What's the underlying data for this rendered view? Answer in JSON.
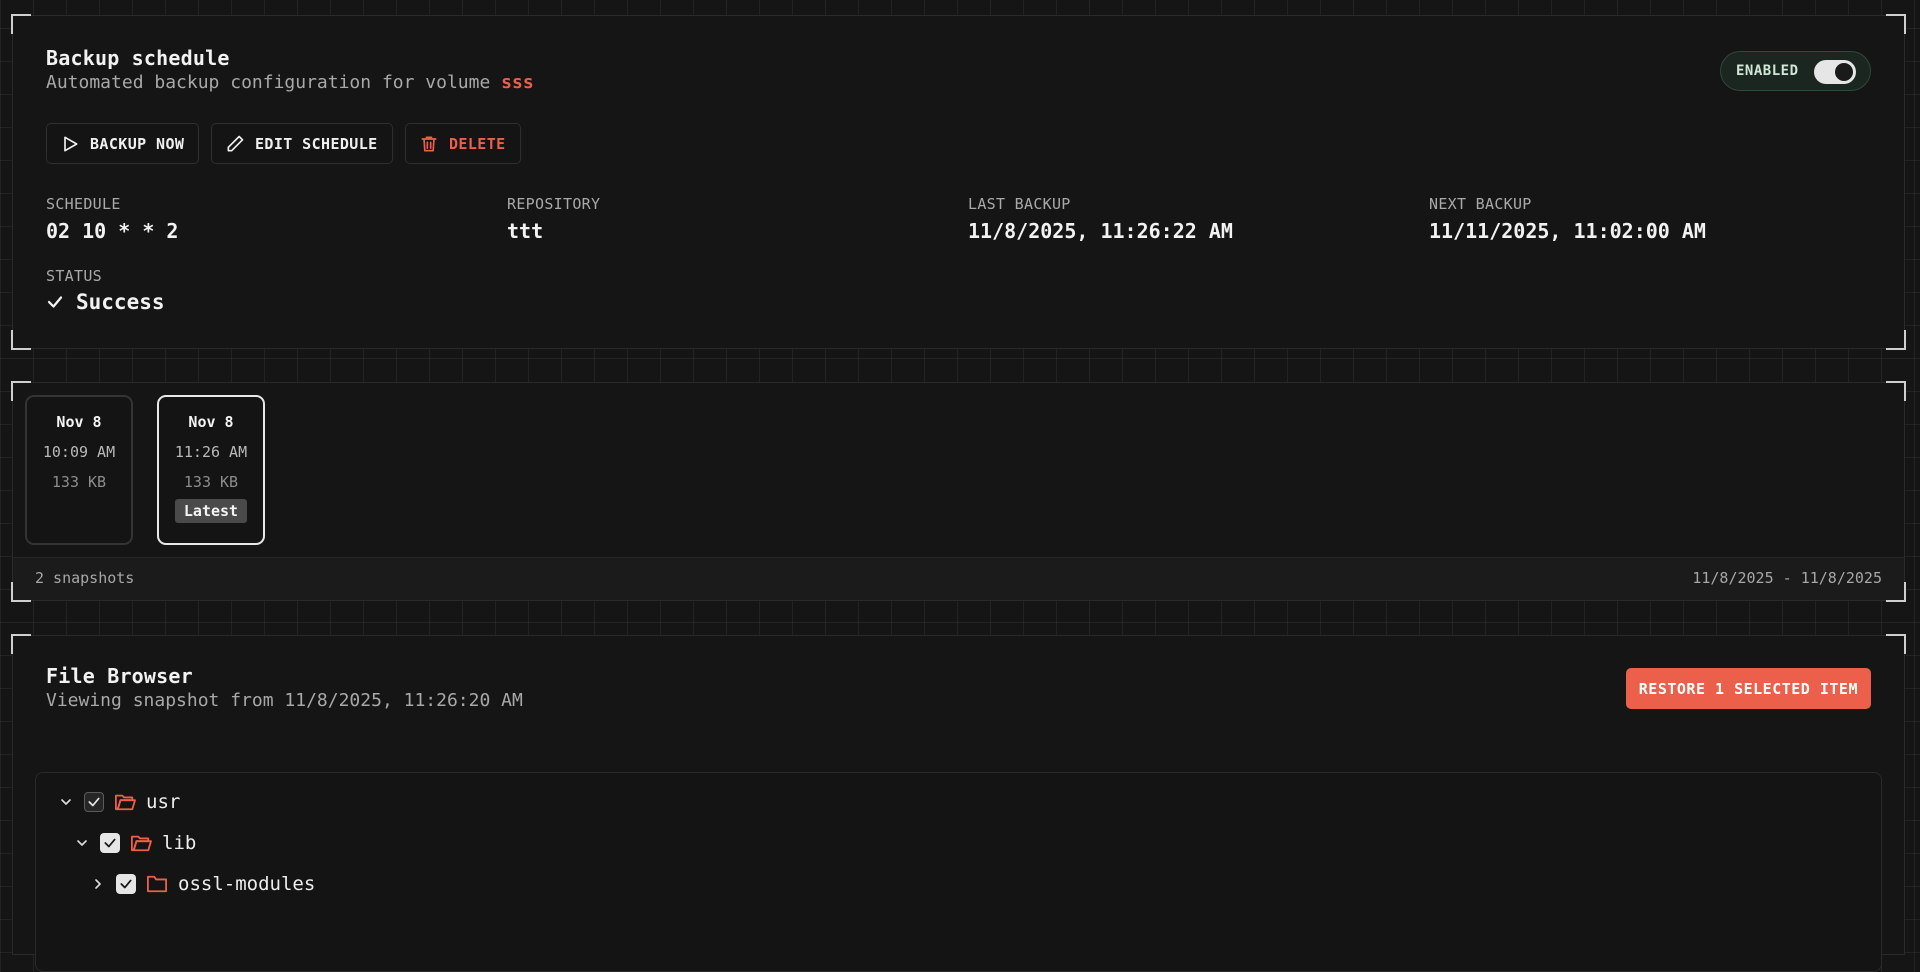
{
  "schedule": {
    "title": "Backup schedule",
    "subtitle_prefix": "Automated backup configuration for volume",
    "volume": "sss",
    "toggle_label": "ENABLED",
    "buttons": {
      "backup_now": "BACKUP NOW",
      "edit_schedule": "EDIT SCHEDULE",
      "delete": "DELETE"
    },
    "fields": {
      "schedule_label": "SCHEDULE",
      "schedule_value": "02 10 * * 2",
      "repository_label": "REPOSITORY",
      "repository_value": "ttt",
      "last_backup_label": "LAST BACKUP",
      "last_backup_value": "11/8/2025, 11:26:22 AM",
      "next_backup_label": "NEXT BACKUP",
      "next_backup_value": "11/11/2025, 11:02:00 AM",
      "status_label": "STATUS",
      "status_value": "Success"
    }
  },
  "snapshots": {
    "items": [
      {
        "date": "Nov 8",
        "time": "10:09 AM",
        "size": "133 KB",
        "badge": ""
      },
      {
        "date": "Nov 8",
        "time": "11:26 AM",
        "size": "133 KB",
        "badge": "Latest"
      }
    ],
    "count_text": "2 snapshots",
    "range_text": "11/8/2025 - 11/8/2025"
  },
  "file_browser": {
    "title": "File Browser",
    "subtitle": "Viewing snapshot from 11/8/2025, 11:26:20 AM",
    "restore_label": "RESTORE 1 SELECTED ITEM",
    "tree": [
      {
        "name": "usr",
        "expanded": true
      },
      {
        "name": "lib",
        "expanded": true
      },
      {
        "name": "ossl-modules",
        "expanded": false
      }
    ]
  },
  "colors": {
    "accent": "#ec5f4a",
    "background": "#151515",
    "enabled_pill": "#1b2620"
  }
}
